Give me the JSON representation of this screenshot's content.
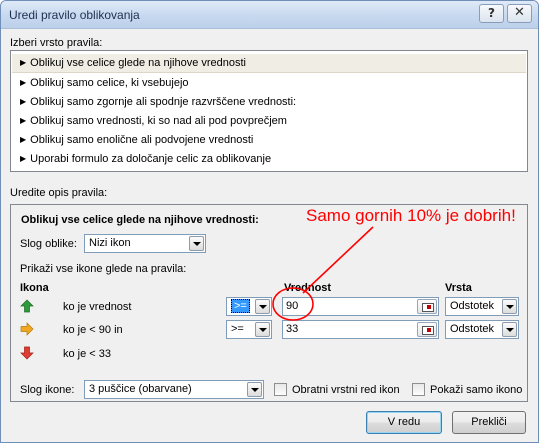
{
  "window": {
    "title": "Uredi pravilo oblikovanja",
    "help_glyph": "?",
    "close_glyph": "✕"
  },
  "rule_type": {
    "label": "Izberi vrsto pravila:",
    "items": [
      "Oblikuj vse celice glede na njihove vrednosti",
      "Oblikuj samo celice, ki vsebujejo",
      "Oblikuj samo zgornje ali spodnje razvrščene vrednosti:",
      "Oblikuj samo vrednosti, ki so nad ali pod povprečjem",
      "Oblikuj samo enolične ali podvojene vrednosti",
      "Uporabi formulo za določanje celic za oblikovanje"
    ],
    "selected_index": 0
  },
  "description": {
    "label": "Uredite opis pravila:",
    "heading": "Oblikuj vse celice glede na njihove vrednosti:",
    "style_label": "Slog oblike:",
    "style_value": "Nizi ikon",
    "show_label": "Prikaži vse ikone glede na pravila:",
    "columns": {
      "icon": "Ikona",
      "value": "Vrednost",
      "type": "Vrsta"
    },
    "rows": [
      {
        "icon": "green-up-arrow-icon",
        "color": "#2e9b3a",
        "text": "ko je vrednost",
        "operator": ">=",
        "value": "90",
        "type": "Odstotek",
        "operator_focused": true
      },
      {
        "icon": "yellow-right-arrow-icon",
        "color": "#f0a820",
        "text": "ko je < 90 in",
        "operator": ">=",
        "value": "33",
        "type": "Odstotek",
        "operator_focused": false
      },
      {
        "icon": "red-down-arrow-icon",
        "color": "#e03c31",
        "text": "ko je < 33"
      }
    ],
    "icon_style_label": "Slog ikone:",
    "icon_style_value": "3 puščice (obarvane)",
    "reverse_label": "Obratni vrstni red ikon",
    "show_icon_only_label": "Pokaži samo ikono"
  },
  "buttons": {
    "ok": "V redu",
    "cancel": "Prekliči"
  },
  "annotation": {
    "text": "Samo gornih 10% je dobrih!",
    "color": "#ff0000"
  }
}
